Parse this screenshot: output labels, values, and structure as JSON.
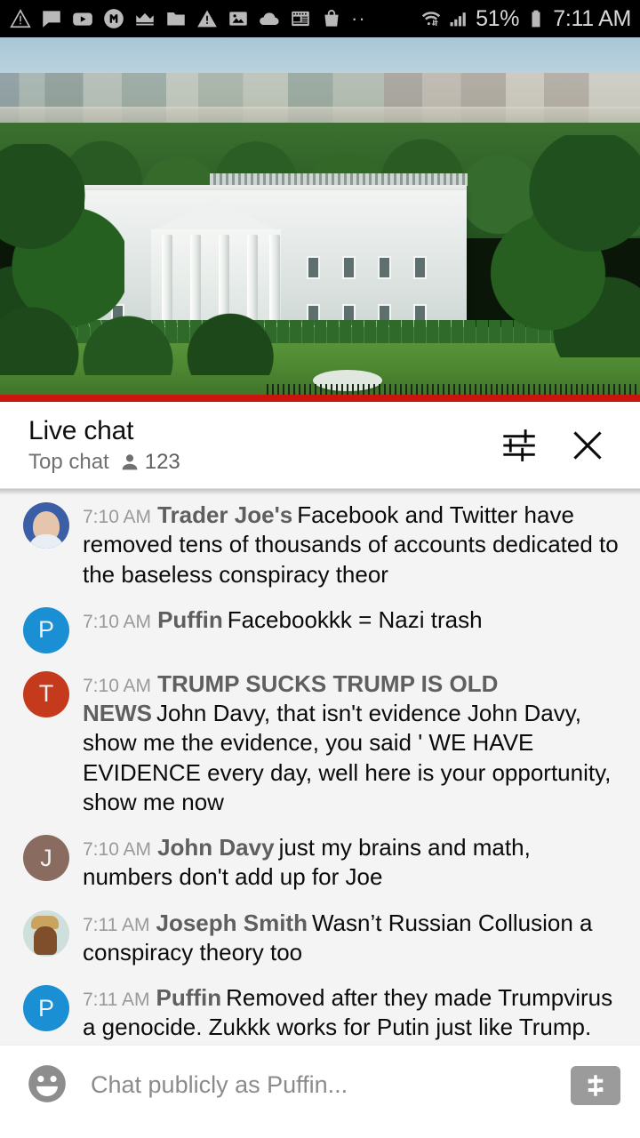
{
  "status_bar": {
    "icons": [
      {
        "name": "warning-triangle-icon"
      },
      {
        "name": "chat-bubble-icon"
      },
      {
        "name": "youtube-icon"
      },
      {
        "name": "messenger-icon"
      },
      {
        "name": "crown-icon"
      },
      {
        "name": "folder-icon"
      },
      {
        "name": "alert-triangle-icon"
      },
      {
        "name": "photo-icon"
      },
      {
        "name": "cloud-icon"
      },
      {
        "name": "news-icon"
      },
      {
        "name": "shopping-bag-icon"
      },
      {
        "name": "more-dots-icon"
      }
    ],
    "wifi_icon": "wifi-transfer-icon",
    "signal_icon": "cell-signal-icon",
    "battery_percent": "51%",
    "battery_icon": "battery-icon",
    "clock": "7:11 AM"
  },
  "video": {
    "name": "white-house-live-stream",
    "progress_color": "#c8160c"
  },
  "chat_header": {
    "title": "Live chat",
    "mode": "Top chat",
    "viewer_icon": "person-icon",
    "viewer_count": "123",
    "settings_icon": "sliders-icon",
    "close_icon": "close-icon"
  },
  "messages": [
    {
      "time": "7:10 AM",
      "author": "Trader Joe's",
      "text": "Facebook and Twitter have removed tens of thousands of accounts dedicated to the baseless conspiracy theor",
      "avatar_type": "photo",
      "avatar_class": "av-photo-biden",
      "avatar_letter": "",
      "avatar_color": "#3b5fa6"
    },
    {
      "time": "7:10 AM",
      "author": "Puffin",
      "text": "Facebookkk = Nazi trash",
      "avatar_type": "letter",
      "avatar_class": "",
      "avatar_letter": "P",
      "avatar_color": "#1a8fd4"
    },
    {
      "time": "7:10 AM",
      "author": "TRUMP SUCKS TRUMP IS OLD NEWS",
      "text": "John Davy, that isn't evidence John Davy, show me the evidence, you said ' WE HAVE EVIDENCE every day, well here is your opportunity, show me now",
      "avatar_type": "letter",
      "avatar_class": "",
      "avatar_letter": "T",
      "avatar_color": "#c53a1c"
    },
    {
      "time": "7:10 AM",
      "author": "John Davy",
      "text": "just my brains and math, numbers don't add up for Joe",
      "avatar_type": "letter",
      "avatar_class": "",
      "avatar_letter": "J",
      "avatar_color": "#8a6b60"
    },
    {
      "time": "7:11 AM",
      "author": "Joseph Smith",
      "text": "Wasn’t Russian Collusion a conspiracy theory too",
      "avatar_type": "photo",
      "avatar_class": "av-photo-bear",
      "avatar_letter": "",
      "avatar_color": "#cfe0dc"
    },
    {
      "time": "7:11 AM",
      "author": "Puffin",
      "text": "Removed after they made Trumpvirus a genocide. Zukkk works for Putin just like Trump. nazi scum",
      "avatar_type": "letter",
      "avatar_class": "",
      "avatar_letter": "P",
      "avatar_color": "#1a8fd4"
    },
    {
      "time": "",
      "author": "",
      "text": "",
      "avatar_type": "letter",
      "avatar_class": "",
      "avatar_letter": "",
      "avatar_color": "#0e8a7d"
    }
  ],
  "composer": {
    "emoji_icon": "emoji-smile-icon",
    "placeholder": "Chat publicly as Puffin...",
    "super_chat_icon": "dollar-icon"
  }
}
